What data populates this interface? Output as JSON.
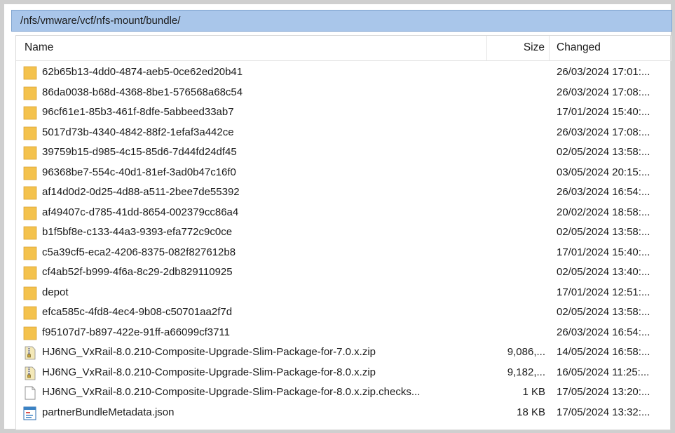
{
  "path": "/nfs/vmware/vcf/nfs-mount/bundle/",
  "columns": {
    "name": "Name",
    "size": "Size",
    "changed": "Changed"
  },
  "rows": [
    {
      "name": "62b65b13-4dd0-4874-aeb5-0ce62ed20b41",
      "size": "",
      "changed": "26/03/2024 17:01:...",
      "icon": "folder-icon"
    },
    {
      "name": "86da0038-b68d-4368-8be1-576568a68c54",
      "size": "",
      "changed": "26/03/2024 17:08:...",
      "icon": "folder-icon"
    },
    {
      "name": "96cf61e1-85b3-461f-8dfe-5abbeed33ab7",
      "size": "",
      "changed": "17/01/2024 15:40:...",
      "icon": "folder-icon"
    },
    {
      "name": "5017d73b-4340-4842-88f2-1efaf3a442ce",
      "size": "",
      "changed": "26/03/2024 17:08:...",
      "icon": "folder-icon"
    },
    {
      "name": "39759b15-d985-4c15-85d6-7d44fd24df45",
      "size": "",
      "changed": "02/05/2024 13:58:...",
      "icon": "folder-icon"
    },
    {
      "name": "96368be7-554c-40d1-81ef-3ad0b47c16f0",
      "size": "",
      "changed": "03/05/2024 20:15:...",
      "icon": "folder-icon"
    },
    {
      "name": "af14d0d2-0d25-4d88-a511-2bee7de55392",
      "size": "",
      "changed": "26/03/2024 16:54:...",
      "icon": "folder-icon"
    },
    {
      "name": "af49407c-d785-41dd-8654-002379cc86a4",
      "size": "",
      "changed": "20/02/2024 18:58:...",
      "icon": "folder-icon"
    },
    {
      "name": "b1f5bf8e-c133-44a3-9393-efa772c9c0ce",
      "size": "",
      "changed": "02/05/2024 13:58:...",
      "icon": "folder-icon"
    },
    {
      "name": "c5a39cf5-eca2-4206-8375-082f827612b8",
      "size": "",
      "changed": "17/01/2024 15:40:...",
      "icon": "folder-icon"
    },
    {
      "name": "cf4ab52f-b999-4f6a-8c29-2db829110925",
      "size": "",
      "changed": "02/05/2024 13:40:...",
      "icon": "folder-icon"
    },
    {
      "name": "depot",
      "size": "",
      "changed": "17/01/2024 12:51:...",
      "icon": "folder-icon"
    },
    {
      "name": "efca585c-4fd8-4ec4-9b08-c50701aa2f7d",
      "size": "",
      "changed": "02/05/2024 13:58:...",
      "icon": "folder-icon"
    },
    {
      "name": "f95107d7-b897-422e-91ff-a66099cf3711",
      "size": "",
      "changed": "26/03/2024 16:54:...",
      "icon": "folder-icon"
    },
    {
      "name": "HJ6NG_VxRail-8.0.210-Composite-Upgrade-Slim-Package-for-7.0.x.zip",
      "size": "9,086,...",
      "changed": "14/05/2024 16:58:...",
      "icon": "zip-icon"
    },
    {
      "name": "HJ6NG_VxRail-8.0.210-Composite-Upgrade-Slim-Package-for-8.0.x.zip",
      "size": "9,182,...",
      "changed": "16/05/2024 11:25:...",
      "icon": "zip-icon"
    },
    {
      "name": "HJ6NG_VxRail-8.0.210-Composite-Upgrade-Slim-Package-for-8.0.x.zip.checks...",
      "size": "1 KB",
      "changed": "17/05/2024 13:20:...",
      "icon": "file-icon"
    },
    {
      "name": "partnerBundleMetadata.json",
      "size": "18 KB",
      "changed": "17/05/2024 13:32:...",
      "icon": "json-file-icon"
    }
  ],
  "colors": {
    "path_bar": "#a9c6ea",
    "folder": "#f4c24d",
    "folder_dark": "#d9a437"
  }
}
